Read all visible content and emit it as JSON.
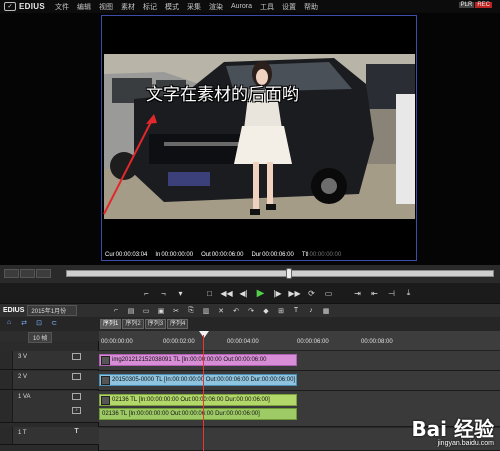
{
  "app": {
    "title": "EDIUS"
  },
  "menu": [
    "文件",
    "编辑",
    "视图",
    "素材",
    "标记",
    "模式",
    "采集",
    "渲染",
    "Aurora",
    "工具",
    "设置",
    "帮助"
  ],
  "mode_badge": {
    "plr": "PLR",
    "rec": "REC"
  },
  "preview": {
    "overlay_text": "文字在素材的后面哟",
    "timecodes": {
      "cur_label": "Cur",
      "cur": "00:00:03:04",
      "in_label": "In",
      "in": "00:00:00:00",
      "out_label": "Out",
      "out": "00:00:06:00",
      "dur_label": "Dur",
      "dur": "00:00:06:00",
      "ttl_label": "Ttl",
      "ttl": "00:00:00:00"
    },
    "scrub_position": 0.52
  },
  "timeline": {
    "title": "EDIUS",
    "project": "2015年1月份",
    "zoom": "10 帧",
    "sequence_tabs": [
      "序列1",
      "序列2",
      "序列3",
      "序列4"
    ],
    "ruler_labels": [
      "00:00:00:00",
      "00:00:02:00",
      "00:00:04:00",
      "00:00:06:00",
      "00:00:08:00"
    ],
    "tracks": [
      {
        "name": "3 V",
        "clip_label": "img201212152038091  TL [In:00:00:00:00 Out:00:00:06:00",
        "clip_color": "#d88ed6"
      },
      {
        "name": "2 V",
        "clip_label": "20150305-0000  TL [In:00:00:00:00 Out:00:00:06:00 Dur:00:00:06:00]",
        "clip_color": "#8fc4e0"
      },
      {
        "name": "1 VA",
        "clip_label": "02136  TL [In:00:00:00:00 Out:00:00:06:00 Dur:00:00:06:00]",
        "clip_color": "#b2d86a"
      },
      {
        "name": "",
        "clip_label": "02136  TL [In:00:00:00:00 Out:00:00:06:00 Dur:00:00:06:00]",
        "clip_color": "#9ecb66"
      },
      {
        "name": "1 T",
        "clip_label": "",
        "clip_color": ""
      }
    ]
  },
  "watermark": {
    "logo": "Bai 经验",
    "url": "jingyan.baidu.com"
  }
}
